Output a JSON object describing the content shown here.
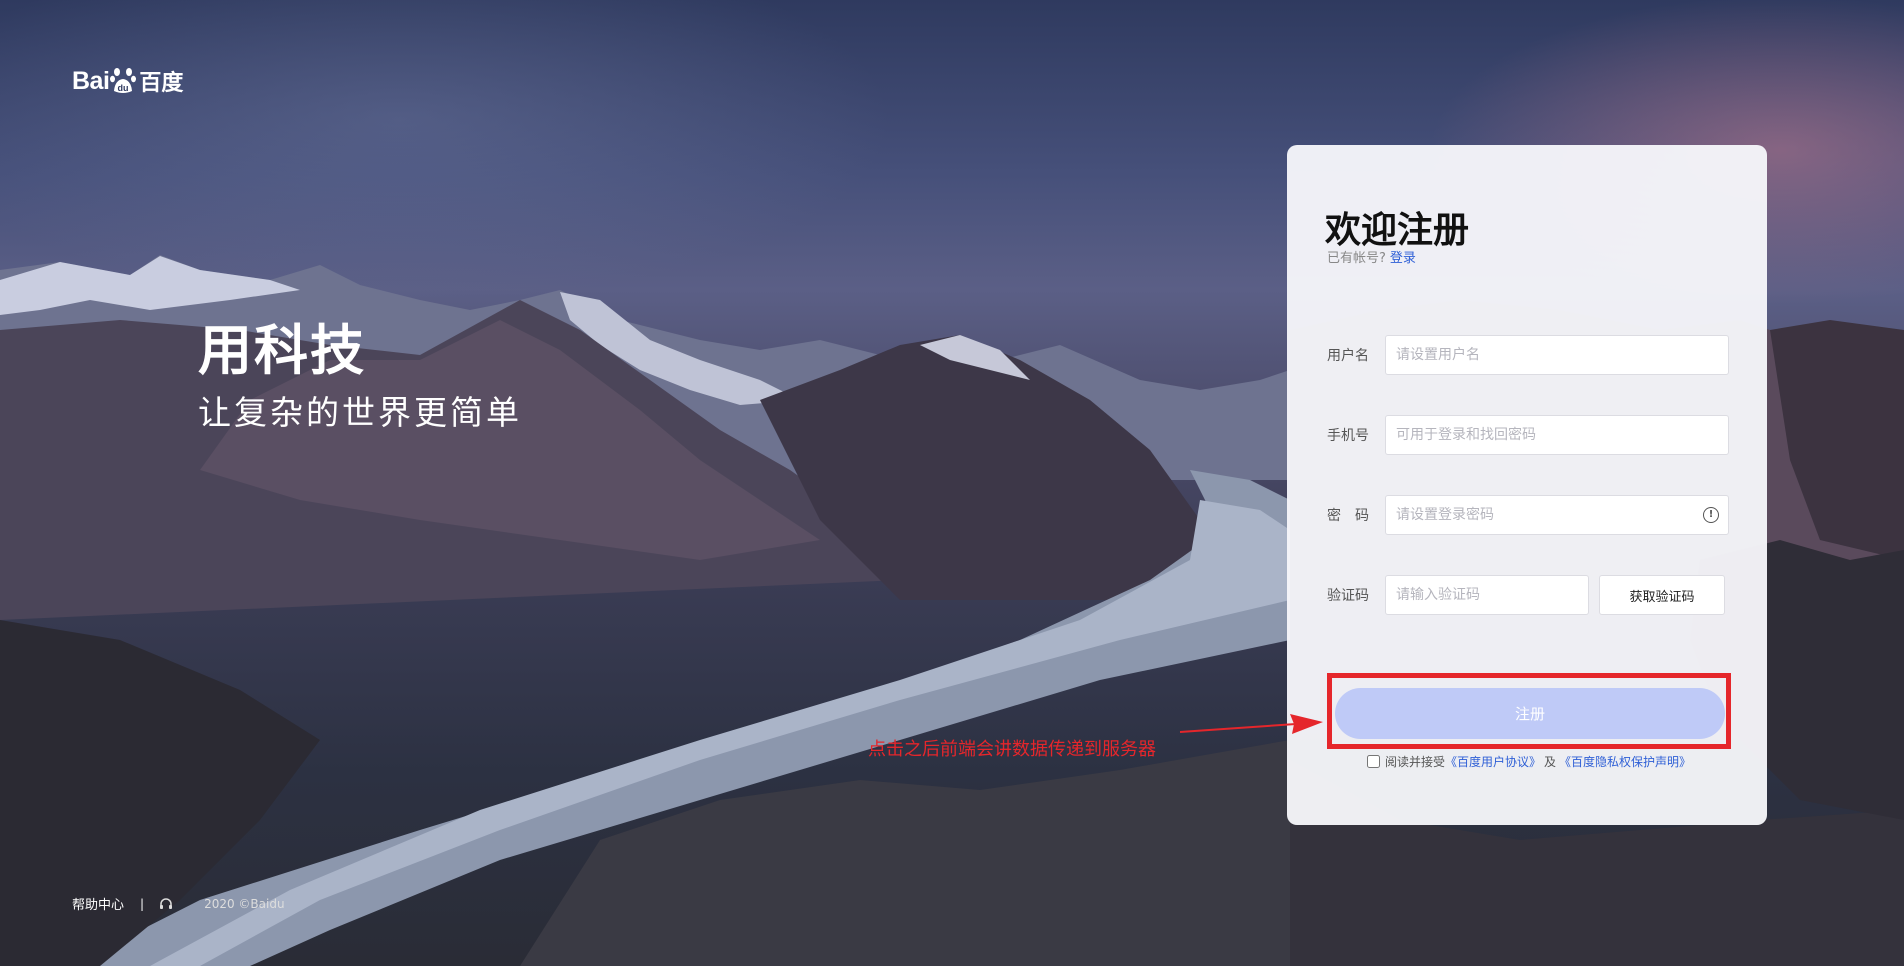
{
  "header": {
    "logo_latin_1": "Bai",
    "logo_paw_text": "du",
    "logo_cn": "百度"
  },
  "slogan": {
    "title": "用科技",
    "subtitle": "让复杂的世界更简单"
  },
  "register": {
    "title": "欢迎注册",
    "has_account": "已有帐号?",
    "login_link": "登录",
    "username_label": "用户名",
    "username_placeholder": "请设置用户名",
    "phone_label": "手机号",
    "phone_placeholder": "可用于登录和找回密码",
    "password_label": "密　码",
    "password_placeholder": "请设置登录密码",
    "password_info_icon": "!",
    "code_label": "验证码",
    "code_placeholder": "请输入验证码",
    "get_code_button": "获取验证码",
    "submit_button": "注册",
    "agree_text": "阅读并接受",
    "user_agreement": "《百度用户协议》",
    "agree_and": "及",
    "privacy_statement": "《百度隐私权保护声明》"
  },
  "annotation": {
    "text": "点击之后前端会讲数据传递到服务器",
    "color": "#e5262b"
  },
  "footer": {
    "help_center": "帮助中心",
    "separator": "|",
    "copyright": "2020 ©Baidu"
  },
  "colors": {
    "accent_link": "#2e5fd6",
    "submit_bg": "#bfcaf7",
    "highlight_red": "#e5262b"
  }
}
